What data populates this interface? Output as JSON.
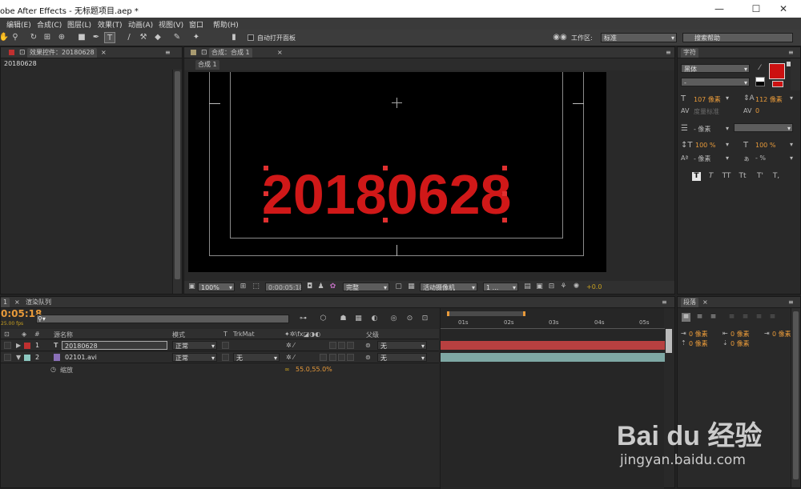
{
  "window": {
    "title": "obe After Effects - 无标题项目.aep *",
    "minimize": "—",
    "maximize": "☐",
    "close": "✕"
  },
  "menu": [
    "编辑(E)",
    "合成(C)",
    "图层(L)",
    "效果(T)",
    "动画(A)",
    "视图(V)",
    "窗口",
    "帮助(H)"
  ],
  "toolbar": {
    "auto_open_label": "自动打开面板",
    "workspace_label": "工作区:",
    "workspace_value": "标准",
    "search_placeholder": "搜索帮助"
  },
  "effect_panel": {
    "tab_label": "效果控件：20180628",
    "layer_name": "20180628"
  },
  "comp_panel": {
    "tab_label": "合成：合成 1",
    "sub_tab": "合成 1",
    "text": "20180628",
    "zoom": "100%",
    "timecode": "0:00:05:18",
    "resolution": "完整",
    "camera": "活动摄像机",
    "views": "1 ...",
    "exposure": "+0.0"
  },
  "character_panel": {
    "tab_label": "字符",
    "font_name": "黑体",
    "font_style": "-",
    "font_size": "107 像素",
    "leading": "112 像素",
    "kerning": "度量标准",
    "tracking": "0",
    "stroke_width": "- 像素",
    "stroke_type": "",
    "vert_scale": "100 %",
    "horiz_scale": "100 %",
    "baseline": "- 像素",
    "tsume": "- %",
    "fill_color": "#cc1111",
    "style_buttons": [
      "T",
      "T",
      "TT",
      "Tt",
      "T'",
      "T,"
    ]
  },
  "paragraph_panel": {
    "tab_label": "段落",
    "indent_left": "0 像素",
    "indent_right": "0 像素",
    "indent_first": "0 像素",
    "space_before": "0 像素",
    "space_after": "0 像素"
  },
  "timeline": {
    "tab_comp": "1",
    "tab_render": "渲染队列",
    "timecode": "0:05:18",
    "fps": "25.00 fps",
    "search_placeholder": "",
    "headers": {
      "num": "#",
      "name": "源名称",
      "mode": "模式",
      "t": "T",
      "trkmat": "TrkMat",
      "parent": "父级"
    },
    "layers": [
      {
        "num": "1",
        "name": "20180628",
        "mode": "正常",
        "trkmat": "",
        "parent": "无",
        "label_color": "#c03030",
        "type": "T"
      },
      {
        "num": "2",
        "name": "02101.avi",
        "mode": "正常",
        "trkmat": "无",
        "parent": "无",
        "label_color": "#8cc8c0",
        "type": "avi"
      }
    ],
    "property": {
      "name": "缩放",
      "value": "55.0,55.0%"
    },
    "ruler": [
      "01s",
      "02s",
      "03s",
      "04s",
      "05s"
    ]
  },
  "watermark": {
    "logo": "Bai du 经验",
    "url": "jingyan.baidu.com"
  }
}
